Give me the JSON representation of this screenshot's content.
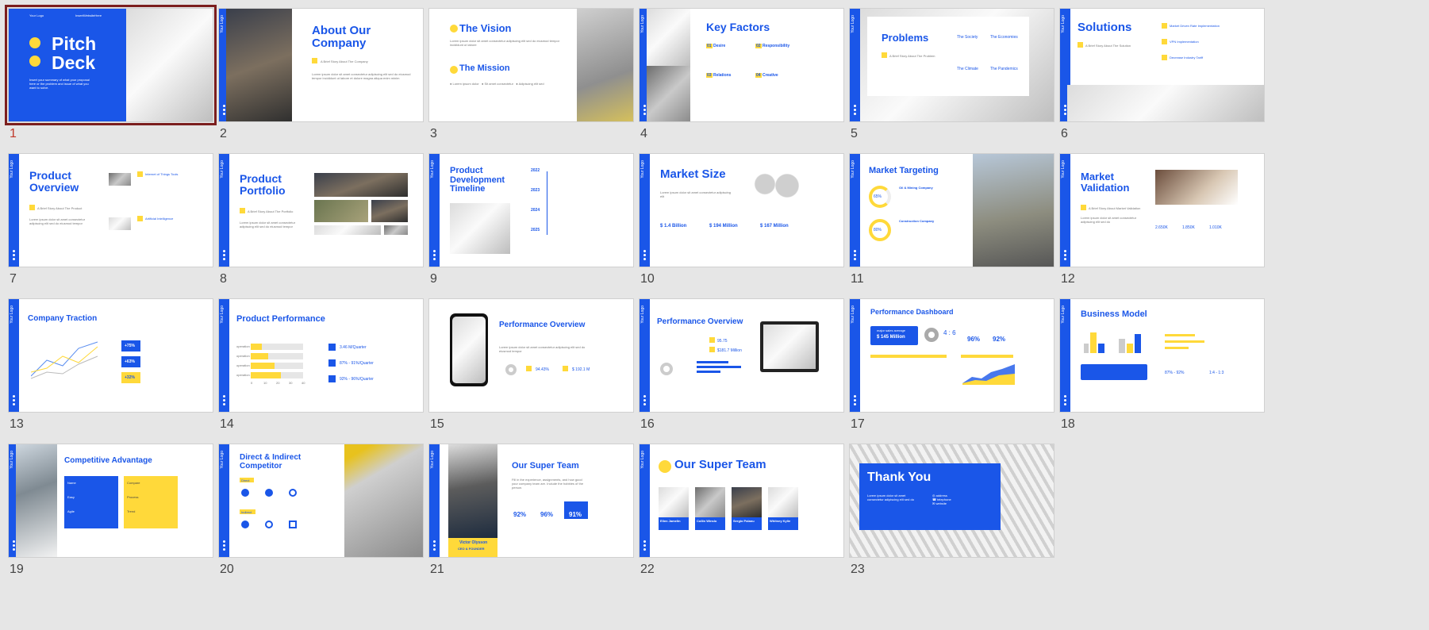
{
  "slides": [
    {
      "num": "1",
      "title": "Pitch\nDeck",
      "logo": "Your Logo",
      "url": "InsertWebsiteHere",
      "sub": "Insert your summary of what your proposal here or the problem and issue of what you want to solve."
    },
    {
      "num": "2",
      "title": "About Our\nCompany",
      "sub": "A Brief Story About The Company"
    },
    {
      "num": "3",
      "title": "The Vision",
      "title2": "The Mission"
    },
    {
      "num": "4",
      "title": "Key Factors",
      "items": [
        "Desire",
        "Responsibility",
        "Relations",
        "Creative"
      ],
      "nums": [
        "01",
        "02",
        "03",
        "04"
      ]
    },
    {
      "num": "5",
      "title": "Problems",
      "sub": "A Brief Story About The Problem",
      "cols": [
        "The Society",
        "The Economies",
        "The Climate",
        "The Pandemics"
      ]
    },
    {
      "num": "6",
      "title": "Solutions",
      "sub": "A Brief Story About The Solution",
      "items": [
        "Market Driven Rate Implementation",
        "VPN Implementation",
        "Decrease Industry Tariff"
      ]
    },
    {
      "num": "7",
      "title": "Product\nOverview",
      "sub": "A Brief Story About The Product",
      "items": [
        "Internet of Things Tools",
        "Artificial Intelligence"
      ]
    },
    {
      "num": "8",
      "title": "Product\nPortfolio",
      "sub": "A Brief Story About The Portfolio"
    },
    {
      "num": "9",
      "title": "Product\nDevelopment\nTimeline",
      "years": [
        "2022",
        "2023",
        "2024",
        "2025"
      ]
    },
    {
      "num": "10",
      "title": "Market Size",
      "values": [
        "$ 1.4 Billion",
        "$ 194 Million",
        "$ 167 Million"
      ]
    },
    {
      "num": "11",
      "title": "Market Targeting",
      "pcts": [
        "65%",
        "80%"
      ],
      "items": [
        "Oil & Mining Company",
        "Construction Company"
      ]
    },
    {
      "num": "12",
      "title": "Market\nValidation",
      "sub": "A Brief Story About Market Validation",
      "values": [
        "2.650K",
        "1.850K",
        "1.010K"
      ]
    },
    {
      "num": "13",
      "title": "Company Traction",
      "values": [
        "+75%",
        "+63%",
        "+32%"
      ]
    },
    {
      "num": "14",
      "title": "Product Performance",
      "values": [
        "3.46 M/Quarter",
        "87% - 91%/Quarter",
        "92% - 96%/Quarter"
      ],
      "cats": [
        "operation 1",
        "operation 2",
        "operation 3",
        "operation 4"
      ],
      "ticks": [
        "0",
        "10",
        "20",
        "30",
        "40"
      ]
    },
    {
      "num": "15",
      "title": "Performance Overview",
      "values": [
        "94.43%",
        "$ 192.1 M"
      ]
    },
    {
      "num": "16",
      "title": "Performance Overview",
      "values": [
        "95.75",
        "$181.7 Million"
      ]
    },
    {
      "num": "17",
      "title": "Performance Dashboard",
      "values": [
        "$ 145 Million",
        "4 : 6",
        "96%",
        "92%"
      ],
      "label": "major sales average"
    },
    {
      "num": "18",
      "title": "Business Model",
      "values": [
        "87% - 92%",
        "1:4 - 1:3"
      ]
    },
    {
      "num": "19",
      "title": "Competitive Advantage",
      "rows": [
        "Name",
        "Easy",
        "Agile",
        "Compare",
        "Process",
        "Trend"
      ]
    },
    {
      "num": "20",
      "title": "Direct & Indirect\nCompetitor",
      "labels": [
        "Direct",
        "Indirect"
      ]
    },
    {
      "num": "21",
      "title": "Our Super Team",
      "person": "Victor Olysson",
      "role": "CEO & FOUNDER",
      "pcts": [
        "92%",
        "96%",
        "91%"
      ]
    },
    {
      "num": "22",
      "title": "Our Super Team",
      "people": [
        "Ellen Jamelin",
        "Collin Winslo",
        "Sergio Palanu",
        "Whitney Kylie"
      ]
    },
    {
      "num": "23",
      "title": "Thank You"
    }
  ]
}
